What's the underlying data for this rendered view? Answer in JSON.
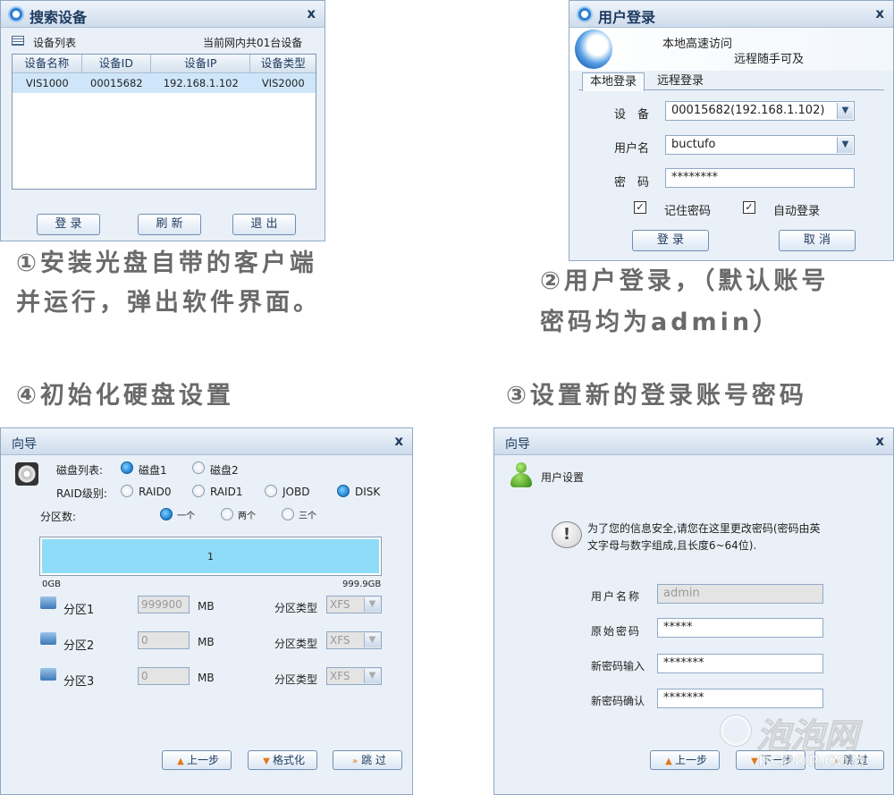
{
  "search_window": {
    "title": "搜索设备",
    "list_label": "设备列表",
    "summary": "当前网内共01台设备",
    "columns": [
      "设备名称",
      "设备ID",
      "设备IP",
      "设备类型"
    ],
    "row": [
      "VIS1000",
      "00015682",
      "192.168.1.102",
      "VIS2000"
    ],
    "buttons": {
      "login": "登 录",
      "refresh": "刷 新",
      "exit": "退 出"
    }
  },
  "login_window": {
    "title": "用户登录",
    "banner_line1": "本地高速访问",
    "banner_line2": "远程随手可及",
    "tabs": [
      "本地登录",
      "远程登录"
    ],
    "device_label": "设　备",
    "device_value": "00015682(192.168.1.102)",
    "username_label": "用户名",
    "username_value": "buctufo",
    "password_label": "密　码",
    "password_value": "********",
    "remember_label": "记住密码",
    "auto_label": "自动登录",
    "login_button": "登 录",
    "cancel_button": "取 消"
  },
  "captions": {
    "step1_line1": "①安装光盘自带的客户端",
    "step1_line2": "并运行，弹出软件界面。",
    "step2_line1": "②用户登录，（默认账号",
    "step2_line2": "密码均为admin）",
    "step3": "③设置新的登录账号密码",
    "step4": "④初始化硬盘设置"
  },
  "disk_window": {
    "title": "向导",
    "disk_list_label": "磁盘列表:",
    "disk_options": [
      "磁盘1",
      "磁盘2"
    ],
    "raid_label": "RAID级别:",
    "raid_options": [
      "RAID0",
      "RAID1",
      "JOBD",
      "DISK"
    ],
    "partition_count_label": "分区数:",
    "partition_count_options": [
      "一个",
      "两个",
      "三个"
    ],
    "bar_label": "1",
    "scale_min": "0GB",
    "scale_max": "999.9GB",
    "partitions": [
      {
        "label": "分区1",
        "value": "999900"
      },
      {
        "label": "分区2",
        "value": "0"
      },
      {
        "label": "分区3",
        "value": "0"
      }
    ],
    "unit": "MB",
    "type_label": "分区类型",
    "type_value": "XFS",
    "prev_button": "上一步",
    "format_button": "格式化",
    "skip_button": "跳 过"
  },
  "user_window": {
    "title": "向导",
    "section_title": "用户设置",
    "notice_line1": "为了您的信息安全,请您在这里更改密码(密码由英",
    "notice_line2": "文字母与数字组成,且长度6~64位).",
    "username_label": "用户名称",
    "username_value": "admin",
    "old_pw_label": "原始密码",
    "old_pw_value": "*****",
    "new_pw_label": "新密码输入",
    "new_pw_value": "*******",
    "confirm_label": "新密码确认",
    "confirm_value": "*******",
    "prev_button": "上一步",
    "next_button": "下一步",
    "skip_button": "跳 过"
  },
  "watermark": {
    "line1": "泡泡网",
    "line2": "PCPOP.COM"
  },
  "colors": {
    "accent": "#2f7fd2",
    "partition_bar": "#8fdcf8",
    "caption": "#6a6a6a"
  }
}
